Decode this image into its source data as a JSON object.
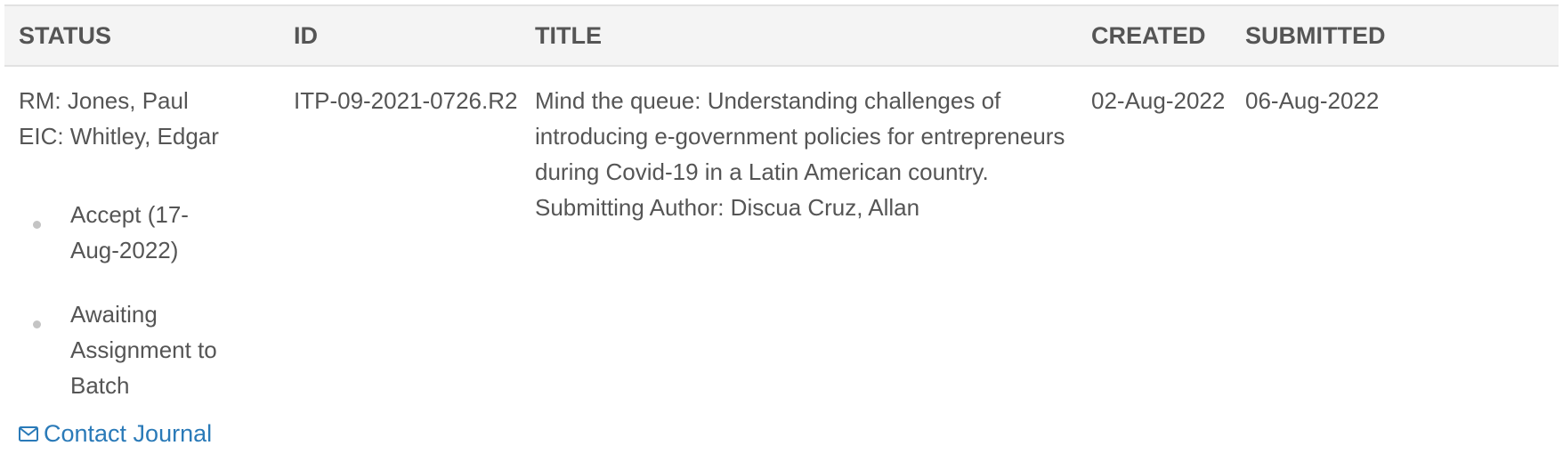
{
  "table": {
    "headers": {
      "status": "STATUS",
      "id": "ID",
      "title": "TITLE",
      "created": "CREATED",
      "submitted": "SUBMITTED"
    },
    "row": {
      "status": {
        "rm": "RM: Jones, Paul",
        "eic": "EIC: Whitley, Edgar",
        "decisions": [
          {
            "line1": "Accept (17-",
            "line2": "Aug-2022)"
          },
          {
            "line1": "Awaiting",
            "line2": "Assignment to",
            "line3": "Batch"
          }
        ],
        "contact_link": "Contact Journal",
        "contact_icon": "envelope-icon"
      },
      "id": "ITP-09-2021-0726.R2",
      "title": {
        "lines": [
          "Mind the queue: Understanding challenges of",
          "introducing e-government policies for entrepreneurs",
          "during Covid-19 in a Latin American country."
        ],
        "submitting_author": "Submitting Author: Discua Cruz, Allan"
      },
      "created": "02-Aug-2022",
      "submitted": "06-Aug-2022"
    }
  },
  "colors": {
    "header_bg": "#f4f4f4",
    "text": "#555555",
    "link": "#2a7ab8",
    "bullet": "#c4c4c4"
  }
}
